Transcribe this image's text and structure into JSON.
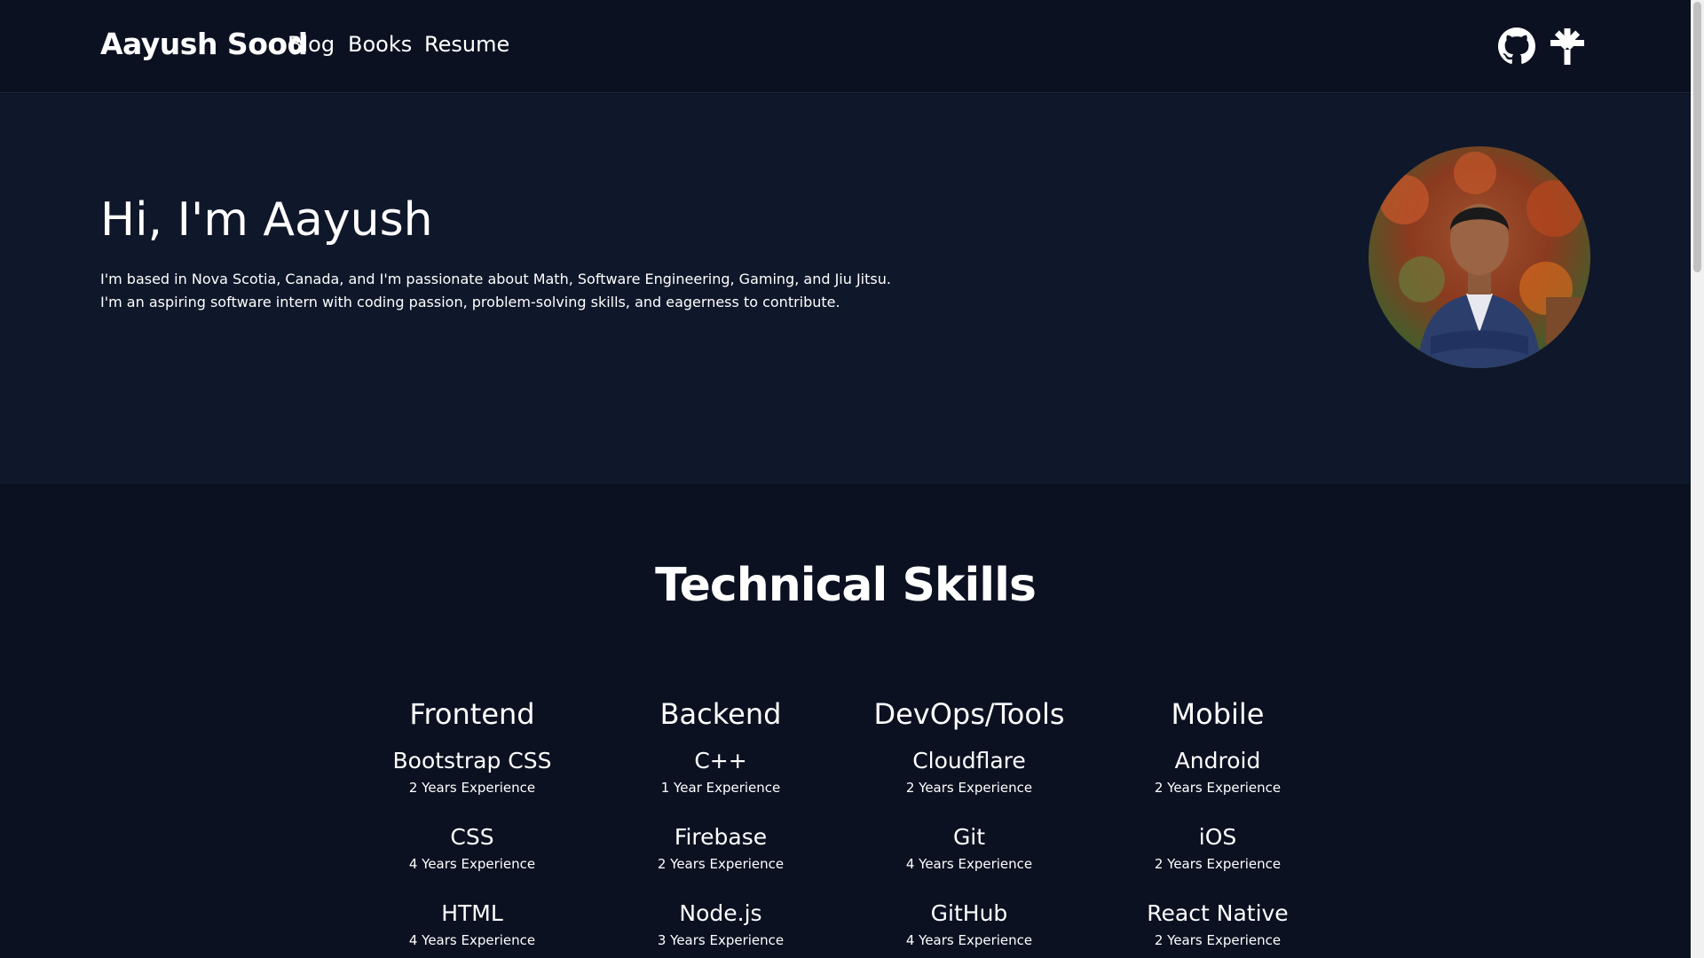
{
  "nav": {
    "brand": "Aayush Sood",
    "links": [
      "Blog",
      "Books",
      "Resume"
    ],
    "icons": [
      "github-icon",
      "linktree-icon"
    ]
  },
  "hero": {
    "title": "Hi, I'm Aayush",
    "line1": "I'm based in Nova Scotia, Canada, and I'm passionate about Math, Software Engineering, Gaming, and Jiu Jitsu.",
    "line2": "I'm an aspiring software intern with coding passion, problem-solving skills, and eagerness to contribute."
  },
  "skills": {
    "title": "Technical Skills",
    "columns": [
      {
        "heading": "Frontend",
        "items": [
          {
            "name": "Bootstrap CSS",
            "exp": "2 Years Experience"
          },
          {
            "name": "CSS",
            "exp": "4 Years Experience"
          },
          {
            "name": "HTML",
            "exp": "4 Years Experience"
          }
        ]
      },
      {
        "heading": "Backend",
        "items": [
          {
            "name": "C++",
            "exp": "1 Year Experience"
          },
          {
            "name": "Firebase",
            "exp": "2 Years Experience"
          },
          {
            "name": "Node.js",
            "exp": "3 Years Experience"
          }
        ]
      },
      {
        "heading": "DevOps/Tools",
        "items": [
          {
            "name": "Cloudflare",
            "exp": "2 Years Experience"
          },
          {
            "name": "Git",
            "exp": "4 Years Experience"
          },
          {
            "name": "GitHub",
            "exp": "4 Years Experience"
          }
        ]
      },
      {
        "heading": "Mobile",
        "items": [
          {
            "name": "Android",
            "exp": "2 Years Experience"
          },
          {
            "name": "iOS",
            "exp": "2 Years Experience"
          },
          {
            "name": "React Native",
            "exp": "2 Years Experience"
          }
        ]
      }
    ]
  },
  "colors": {
    "background": "#0b1121",
    "hero_background": "#0f172a",
    "text": "#ffffff"
  }
}
